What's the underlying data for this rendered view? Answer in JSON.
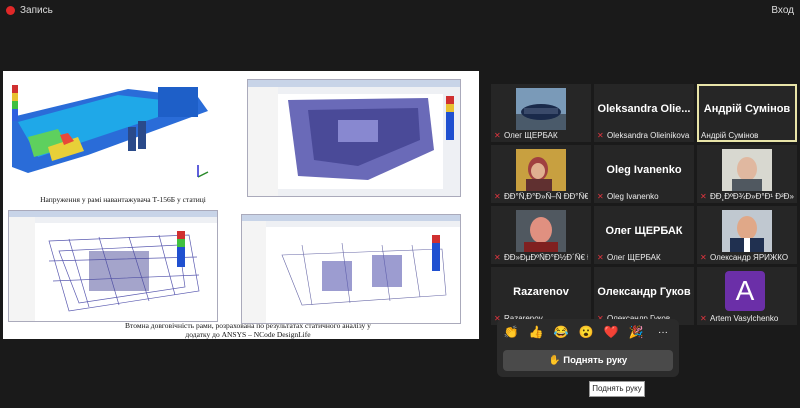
{
  "topbar": {
    "record_label": "Запись",
    "login_label": "Вход"
  },
  "share": {
    "caption1": "Напруження у рамі навантажувача Т-156Б у статиці",
    "caption2": "Втомна довговічність рами, розрахована по результатах статичного аналізу у додатку до ANSYS – NCode DesignLife"
  },
  "participants": [
    {
      "name": "Олег ЩЕРБАК",
      "display": "",
      "has_video": true,
      "video": "car"
    },
    {
      "name": "Oleksandra Olieinikova",
      "display": "Oleksandra  Olie...",
      "has_video": false
    },
    {
      "name": "Андрій Сумінов",
      "display": "Андрій Сумінов",
      "has_video": false,
      "active": true
    },
    {
      "name": "ÐÐ°Ñ‚Ð°Ð»Ñ–Ñ ÐÐ°Ñ€...",
      "display": "",
      "has_video": true,
      "video": "woman"
    },
    {
      "name": "Oleg Ivanenko",
      "display": "Oleg Ivanenko",
      "has_video": false
    },
    {
      "name": "ÐÐ¸ÐºÐ¾Ð»Ð°Ð¹ Ð²Ð»...",
      "display": "",
      "has_video": true,
      "video": "man1"
    },
    {
      "name": "ÐÐ»ÐµÐºÑÐ°Ð½Ð´Ñ€ ÐšÑ–...",
      "display": "",
      "has_video": true,
      "video": "man2"
    },
    {
      "name": "Олег ЩЕРБАК",
      "display": "Олег ЩЕРБАК",
      "has_video": false
    },
    {
      "name": "Олександр ЯРИЖКО",
      "display": "",
      "has_video": true,
      "video": "man3"
    },
    {
      "name": "Razarenov",
      "display": "Razarenov",
      "has_video": false
    },
    {
      "name": "Олександр Гуков",
      "display": "Олександр Гуков",
      "has_video": false
    },
    {
      "name": "Artem Vasylchenko",
      "display": "",
      "has_video": false,
      "avatar_letter": "A",
      "avatar_color": "#6b2fa8"
    }
  ],
  "reactions": {
    "emojis": [
      "👏",
      "👍",
      "😂",
      "😮",
      "❤️",
      "🎉",
      "···"
    ],
    "raise_hand_label": "✋ Поднять руку",
    "tooltip": "Поднять руку"
  }
}
